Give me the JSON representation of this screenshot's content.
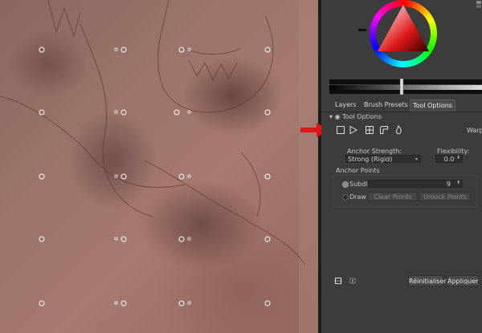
{
  "tabs": [
    {
      "label": "Layers",
      "active": false
    },
    {
      "label": "Brush Presets",
      "active": false
    },
    {
      "label": "Tool Options",
      "active": true
    }
  ],
  "tool_options": {
    "header": "Tool Options",
    "mode_label": "Warp",
    "icons": [
      "warp-icon",
      "cage-icon",
      "liquify-icon",
      "perspective-icon",
      "grid-icon"
    ],
    "anchor_strength_label": "Anchor Strength:",
    "anchor_strength_value": "Strong (Rigid)",
    "flexibility_label": "Flexibility:",
    "flexibility_value": "0.0",
    "anchor_points_label": "Anchor Points",
    "subdivide_label": "Subdivide",
    "subdivide_value": "9",
    "draw_label": "Draw",
    "clear_points_label": "Clear Points",
    "unlock_points_label": "Unlock Points"
  },
  "bottom_bar": {
    "reset_label": "Réinitialiser",
    "apply_label": "Appliquer"
  },
  "colors": {
    "panel_bg": "#3c3c3c",
    "field_bg": "#2f2f2f",
    "arrow_red": "#e21414"
  }
}
